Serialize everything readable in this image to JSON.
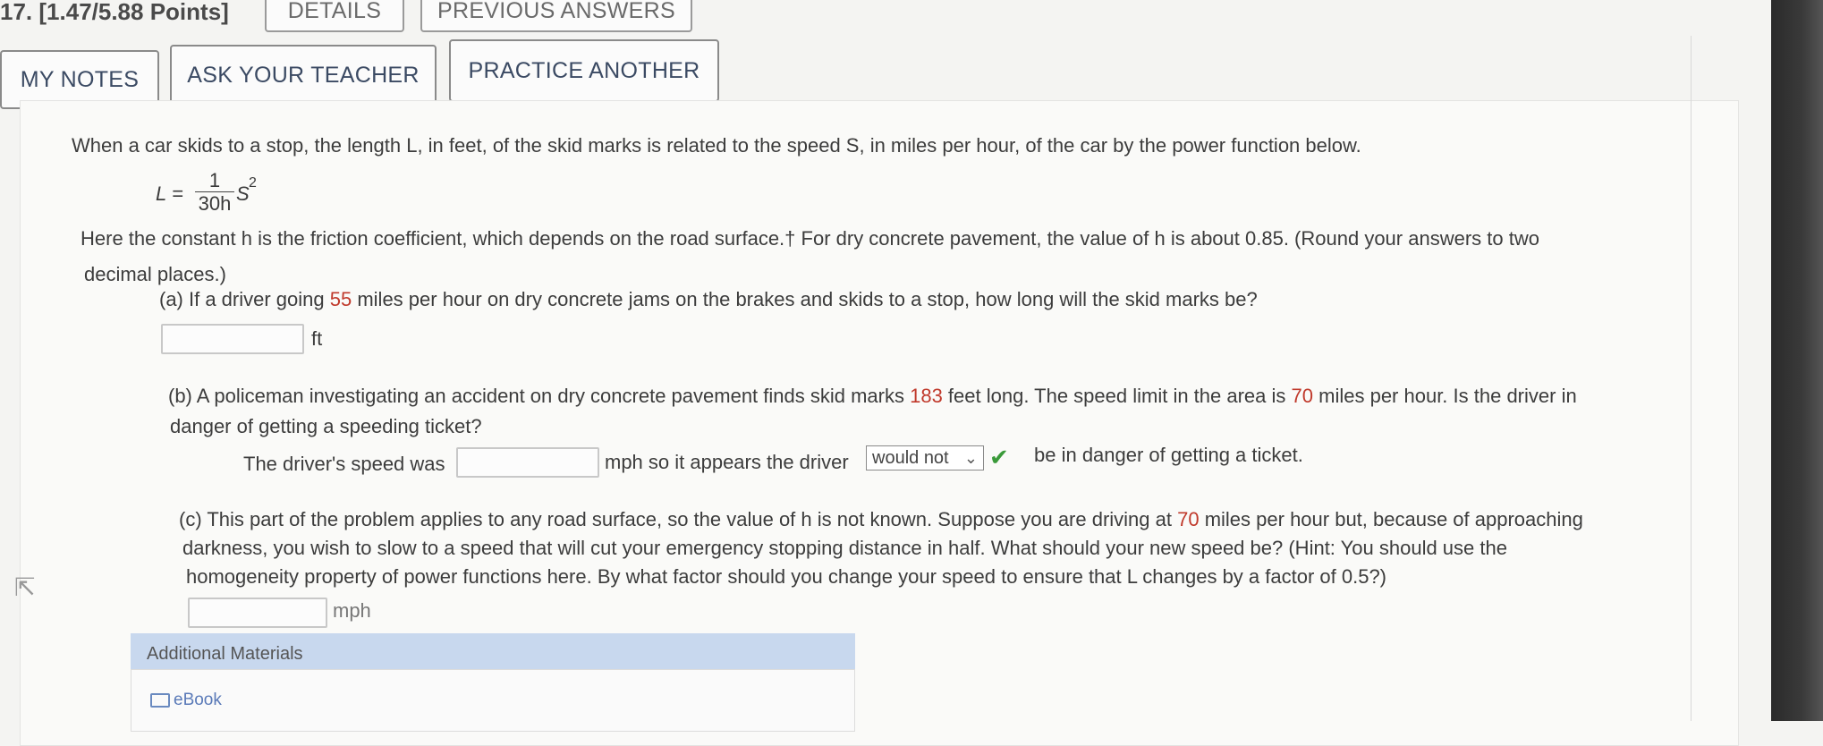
{
  "header": {
    "question_number": "17.",
    "points": "[1.47/5.88 Points]",
    "details_label": "DETAILS",
    "previous_answers_label": "PREVIOUS ANSWERS",
    "my_notes_label": "MY NOTES",
    "ask_teacher_label": "ASK YOUR TEACHER",
    "practice_another_label": "PRACTICE ANOTHER"
  },
  "problem": {
    "intro": "When a car skids to a stop, the length L, in feet, of the skid marks is related to the speed S, in miles per hour, of the car by the power function below.",
    "formula_lhs": "L =",
    "formula_num": "1",
    "formula_den": "30h",
    "formula_var": "S",
    "formula_exp": "2",
    "const_line1": "Here the constant h is the friction coefficient, which depends on the road surface.† For dry concrete pavement, the value of h is about 0.85. (Round your answers to two",
    "const_line2": "decimal places.)"
  },
  "part_a": {
    "text_before": "(a) If a driver going ",
    "speed": "55",
    "text_after": " miles per hour on dry concrete jams on the brakes and skids to a stop, how long will the skid marks be?",
    "answer_value": "",
    "unit": "ft"
  },
  "part_b": {
    "line1_before": "(b) A policeman investigating an accident on dry concrete pavement finds skid marks ",
    "length": "183",
    "line1_mid": " feet long. The speed limit in the area is ",
    "limit": "70",
    "line1_after": " miles per hour. Is the driver in",
    "line2": "danger of getting a speeding ticket?",
    "speed_prefix": "The driver's speed was",
    "speed_value": "",
    "speed_suffix": "mph so it appears the driver",
    "select_value": "would not",
    "end_text": "be in danger of getting a ticket."
  },
  "part_c": {
    "line1_before": "(c) This part of the problem applies to any road surface, so the value of h is not known. Suppose you are driving at ",
    "speed": "70",
    "line1_after": " miles per hour but, because of approaching",
    "line2": "darkness, you wish to slow to a speed that will cut your emergency stopping distance in half. What should your new speed be? (Hint: You should use the",
    "line3": "homogeneity property of power functions here. By what factor should you change your speed to ensure that L changes by a factor of 0.5?)",
    "answer_value": "",
    "unit": "mph"
  },
  "additional": {
    "title": "Additional Materials",
    "ebook": "eBook"
  },
  "colors": {
    "highlight_red": "#c0392b",
    "check_green": "#3a9a3a",
    "materials_bar": "#c8d8ee"
  }
}
